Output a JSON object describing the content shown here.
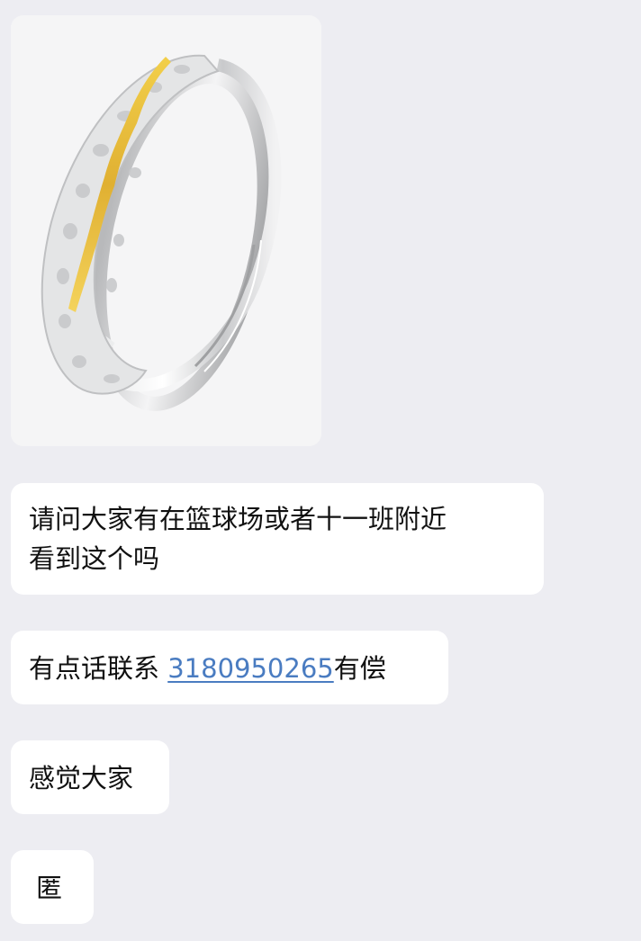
{
  "chat": {
    "image": {
      "subject": "silver ring with gold inlay"
    },
    "messages": [
      {
        "line1": "请问大家有在篮球场或者十一班附近",
        "line2": "看到这个吗"
      },
      {
        "prefix": "有点话联系 ",
        "phone": "3180950265",
        "suffix": "有偿"
      },
      {
        "text": "感觉大家"
      },
      {
        "text": "匿"
      }
    ]
  },
  "colors": {
    "background": "#ededf2",
    "bubble": "#ffffff",
    "text": "#111111",
    "link": "#4a7cc1",
    "ring_silver": "#d9dadb",
    "ring_gold": "#e0b032"
  }
}
